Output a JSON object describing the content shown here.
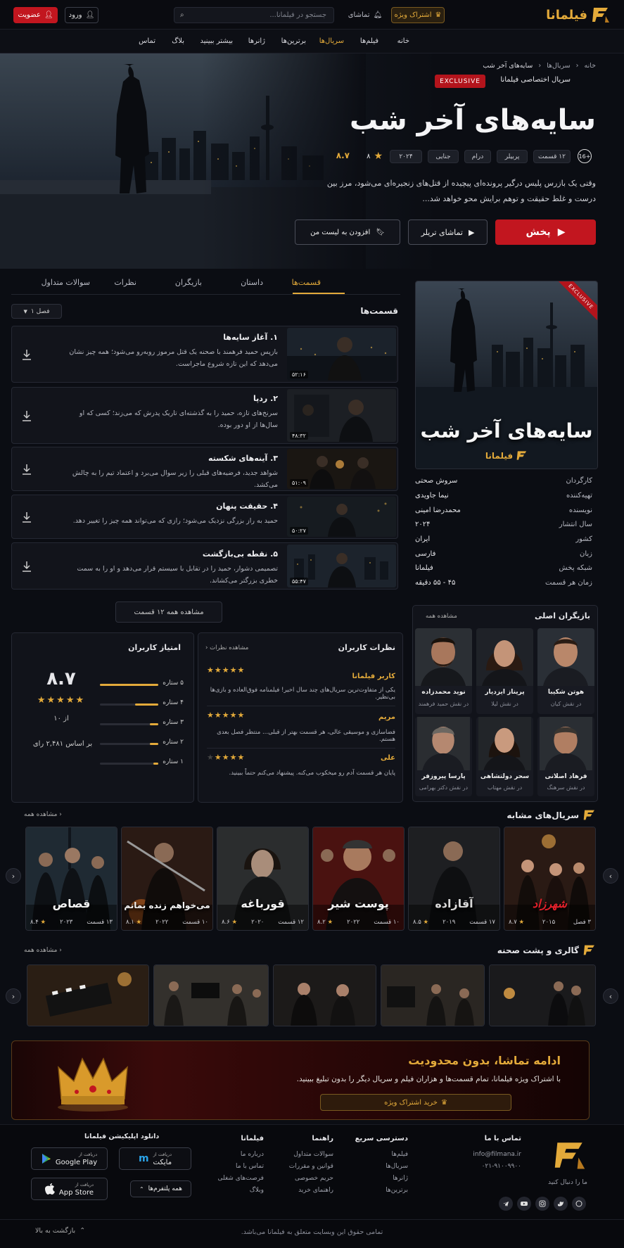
{
  "brand": {
    "name": "فیلمانا"
  },
  "header": {
    "vip_label": "اشتراک ویژه",
    "watchlist_label": "تماشای",
    "search_placeholder": "جستجو در فیلمانا...",
    "login_label": "ورود",
    "signup_label": "عضویت"
  },
  "nav": [
    "خانه",
    "فیلم‌ها",
    "سریال‌ها",
    "برترین‌ها",
    "ژانرها",
    "بیشتر ببینید",
    "بلاگ",
    "تماس"
  ],
  "breadcrumb": [
    "خانه",
    "سریال‌ها",
    "سایه‌های آخر شب"
  ],
  "hero": {
    "exclusive_badge": "EXCLUSIVE",
    "exclusive_text": "سریال اختصاصی فیلمانا",
    "title": "سایه‌های آخر شب",
    "age": "16+",
    "chips": [
      "۱۲ قسمت",
      "پربیلر",
      "درام",
      "جنایی",
      "۲۰۲۴"
    ],
    "votes": "۸",
    "rating": "۸.۷",
    "description_line1": "وقتی یک بازرس پلیس درگیر پرونده‌ای پیچیده از قتل‌های زنجیره‌ای می‌شود، مرز بین",
    "description_line2": "درست و غلط حقیقت و توهم برایش محو خواهد شد...",
    "play_label": "پخش",
    "trailer_label": "تماشای تریلر",
    "list_label": "افزودن به لیست من"
  },
  "tabs": [
    "قسمت‌ها",
    "داستان",
    "بازیگران",
    "نظرات",
    "سوالات متداول"
  ],
  "episodes_section": {
    "title": "قسمت‌ها",
    "season_label": "فصل ۱",
    "view_all": "مشاهده همه ۱۲ قسمت",
    "items": [
      {
        "title": "۱.  آغاز سایه‌ها",
        "desc": "بازپس حمید فرهمند با صحنه یک قتل مرموز روبه‌رو می‌شود؛ همه چیز نشان می‌دهد که این تازه شروع ماجراست.",
        "duration": "۵۲:۱۶"
      },
      {
        "title": "۲.  ردپا",
        "desc": "سرنخ‌های تازه، حمید را به گذشته‌ای تاریک پدرش که می‌زند؛ کسی که او سال‌ها از او دور بوده.",
        "duration": "۴۸:۳۲"
      },
      {
        "title": "۳.  آینه‌های شکسته",
        "desc": "شواهد جدید، فرضیه‌های قبلی را زیر سوال می‌برد و اعتماد تیم را به چالش می‌کشد.",
        "duration": "۵۱:۰۹"
      },
      {
        "title": "۴.  حقیقت پنهان",
        "desc": "حمید به راز بزرگی نزدیک می‌شود؛ رازی که می‌تواند همه چیز را تغییر دهد.",
        "duration": "۵۰:۲۷"
      },
      {
        "title": "۵.  نقطه بی‌بازگشت",
        "desc": "تصمیمی دشوار، حمید را در تقابل با سیستم قرار می‌دهد و او را به سمت خطری بزرگتر می‌کشاند.",
        "duration": "۵۵:۴۷"
      }
    ]
  },
  "poster": {
    "badge": "EXCLUSIVE",
    "title": "سایه‌های آخر شب",
    "brand": "فیلمانا"
  },
  "info": [
    {
      "k": "کارگردان",
      "v": "سروش صحتی"
    },
    {
      "k": "تهیه‌کننده",
      "v": "نیما جاویدی"
    },
    {
      "k": "نویسنده",
      "v": "محمدرضا امینی"
    },
    {
      "k": "سال انتشار",
      "v": "۲۰۲۴"
    },
    {
      "k": "کشور",
      "v": "ایران"
    },
    {
      "k": "زبان",
      "v": "فارسی"
    },
    {
      "k": "شبکه پخش",
      "v": "فیلمانا"
    },
    {
      "k": "زمان هر قسمت",
      "v": "۴۵ - ۵۵ دقیقه"
    }
  ],
  "cast": {
    "title": "بازیگران اصلی",
    "view_all": "مشاهده همه",
    "items": [
      {
        "name": "هوتن شکیبا",
        "role": "در نقش کیان"
      },
      {
        "name": "پریناز ایزدیار",
        "role": "در نقش لیلا"
      },
      {
        "name": "نوید محمدزاده",
        "role": "در نقش حمید فرهمند"
      },
      {
        "name": "فرهاد اصلانی",
        "role": "در نقش سرهنگ"
      },
      {
        "name": "سحر دولتشاهی",
        "role": "در نقش مهتاب"
      },
      {
        "name": "پارسا پیروزفر",
        "role": "در نقش دکتر بهرامی"
      }
    ]
  },
  "reviews": {
    "title": "نظرات کاربران",
    "view_all": "مشاهده نظرات",
    "items": [
      {
        "name": "کاربر فیلمانا",
        "text": "یکی از متفاوت‌ترین سریال‌های چند سال اخیر! فیلمنامه فوق‌العاده و بازی‌ها بی‌نظیر.",
        "stars": 5
      },
      {
        "name": "مریم",
        "text": "فضاسازی و موسیقی عالی، هر قسمت بهتر از قبلی... منتظر فصل بعدی هستم.",
        "stars": 5
      },
      {
        "name": "علی",
        "text": "پایان هر قسمت آدم رو میخکوب می‌کنه. پیشنهاد می‌کنم حتماً ببینید.",
        "stars": 4
      }
    ]
  },
  "user_rating": {
    "title": "امتیاز کاربران",
    "score": "۸.۷",
    "out_of": "از ۱۰",
    "votes_text": "بر اساس ۲,۴۸۱ رای",
    "bars": [
      {
        "label": "۵ ستاره",
        "fraction": 1.0
      },
      {
        "label": "۴ ستاره",
        "fraction": 0.4
      },
      {
        "label": "۳ ستاره",
        "fraction": 0.15
      },
      {
        "label": "۲ ستاره",
        "fraction": 0.15
      },
      {
        "label": "۱ ستاره",
        "fraction": 0.08
      }
    ]
  },
  "similar": {
    "title": "سریال‌های مشابه",
    "view_all": "مشاهده همه",
    "items": [
      {
        "title": "شهرزاد",
        "episodes": "۳ فصل",
        "year": "۲۰۱۵",
        "rating": "۸.۷"
      },
      {
        "title": "آقازاده",
        "episodes": "۱۷ قسمت",
        "year": "۲۰۱۹",
        "rating": "۸.۵"
      },
      {
        "title": "پوست شیر",
        "episodes": "۱۰ قسمت",
        "year": "۲۰۲۲",
        "rating": "۸.۲"
      },
      {
        "title": "قورباغه",
        "episodes": "۱۲ قسمت",
        "year": "۲۰۲۰",
        "rating": "۸.۶"
      },
      {
        "title": "می‌خواهم زنده بمانم",
        "episodes": "۱۰ قسمت",
        "year": "۲۰۲۲",
        "rating": "۸.۱"
      },
      {
        "title": "قصاص",
        "episodes": "۱۳ قسمت",
        "year": "۲۰۲۳",
        "rating": "۸.۴"
      }
    ]
  },
  "gallery": {
    "title": "گالری و پشت صحنه",
    "view_all": "مشاهده همه"
  },
  "promo": {
    "title": "ادامه تماشا، بدون محدودیت",
    "text": "با اشتراک ویژه فیلمانا، تمام قسمت‌ها و هزاران فیلم و سریال دیگر را بدون تبلیغ ببینید.",
    "button": "خرید اشتراک ویژه"
  },
  "footer": {
    "follow": "ما را دنبال کنید",
    "contact_title": "تماس با ما",
    "email": "info@filmana.ir",
    "phone": "۰۲۱-۹۱۰۰۹۹۰۰",
    "quick_title": "دسترسی سریع",
    "quick": [
      "فیلم‌ها",
      "سریال‌ها",
      "ژانرها",
      "برترین‌ها"
    ],
    "guide_title": "راهنما",
    "guide": [
      "سوالات متداول",
      "قوانین و مقررات",
      "حریم خصوصی",
      "راهنمای خرید"
    ],
    "filmana_title": "فیلمانا",
    "filmana": [
      "درباره ما",
      "تماس با ما",
      "فرصت‌های شغلی",
      "وبلاگ"
    ],
    "app_title": "دانلود اپلیکیشن فیلمانا",
    "myket_small": "دریافت از",
    "myket": "مایکت",
    "gplay_small": "دریافت از",
    "gplay": "Google Play",
    "appstore_small": "دریافت از",
    "appstore": "App Store",
    "all_platforms": "همه پلتفرم‌ها",
    "copyright": "تمامی حقوق این وبسایت متعلق به فیلمانا می‌باشد.",
    "back_top": "بازگشت به بالا"
  },
  "colors": {
    "accent": "#e3aa3a",
    "primary_red": "#c2161f",
    "bg": "#0b0d13"
  }
}
